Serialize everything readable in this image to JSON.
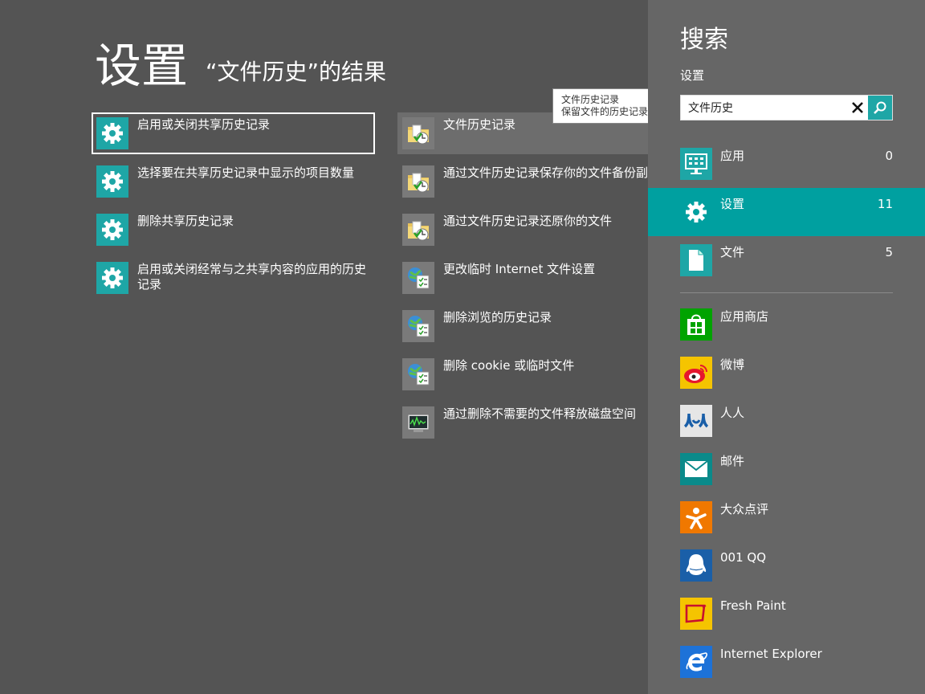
{
  "header": {
    "title": "设置",
    "subtitle": "“文件历史”的结果"
  },
  "results_left": [
    {
      "label": "启用或关闭共享历史记录",
      "icon": "gear-icon"
    },
    {
      "label": "选择要在共享历史记录中显示的项目数量",
      "icon": "gear-icon"
    },
    {
      "label": "删除共享历史记录",
      "icon": "gear-icon"
    },
    {
      "label": "启用或关闭经常与之共享内容的应用的历史记录",
      "icon": "gear-icon"
    }
  ],
  "results_right": [
    {
      "label": "文件历史记录",
      "icon": "file-history-icon"
    },
    {
      "label": "通过文件历史记录保存你的文件备份副本",
      "icon": "file-history-icon"
    },
    {
      "label": "通过文件历史记录还原你的文件",
      "icon": "file-history-icon"
    },
    {
      "label": "更改临时 Internet 文件设置",
      "icon": "internet-options-icon"
    },
    {
      "label": "删除浏览的历史记录",
      "icon": "internet-options-icon"
    },
    {
      "label": "删除 cookie 或临时文件",
      "icon": "internet-options-icon"
    },
    {
      "label": "通过删除不需要的文件释放磁盘空间",
      "icon": "disk-cleanup-icon"
    }
  ],
  "tooltip": {
    "line1": "文件历史记录",
    "line2": "保留文件的历史记录"
  },
  "search_pane": {
    "title": "搜索",
    "scope": "设置",
    "query": "文件历史",
    "scopes": [
      {
        "label": "应用",
        "count": "0",
        "icon": "apps-icon"
      },
      {
        "label": "设置",
        "count": "11",
        "icon": "gear-icon"
      },
      {
        "label": "文件",
        "count": "5",
        "icon": "file-icon"
      }
    ],
    "apps": [
      {
        "label": "应用商店",
        "icon": "store-icon",
        "color": "#00a300"
      },
      {
        "label": "微博",
        "icon": "weibo-icon",
        "color": "#f5c400"
      },
      {
        "label": "人人",
        "icon": "renren-icon",
        "color": "#e6e6e6"
      },
      {
        "label": "邮件",
        "icon": "mail-icon",
        "color": "#0a8a8a"
      },
      {
        "label": "大众点评",
        "icon": "dianping-icon",
        "color": "#f07800"
      },
      {
        "label": "001 QQ",
        "icon": "qq-icon",
        "color": "#1a5fa8"
      },
      {
        "label": "Fresh Paint",
        "icon": "fresh-paint-icon",
        "color": "#f5c400"
      },
      {
        "label": "Internet Explorer",
        "icon": "internet-explorer-icon",
        "color": "#1d72d8"
      }
    ]
  },
  "colors": {
    "background": "#545454",
    "pane": "#666666",
    "accent": "#1ea6a6",
    "selected": "#00a0a0"
  }
}
